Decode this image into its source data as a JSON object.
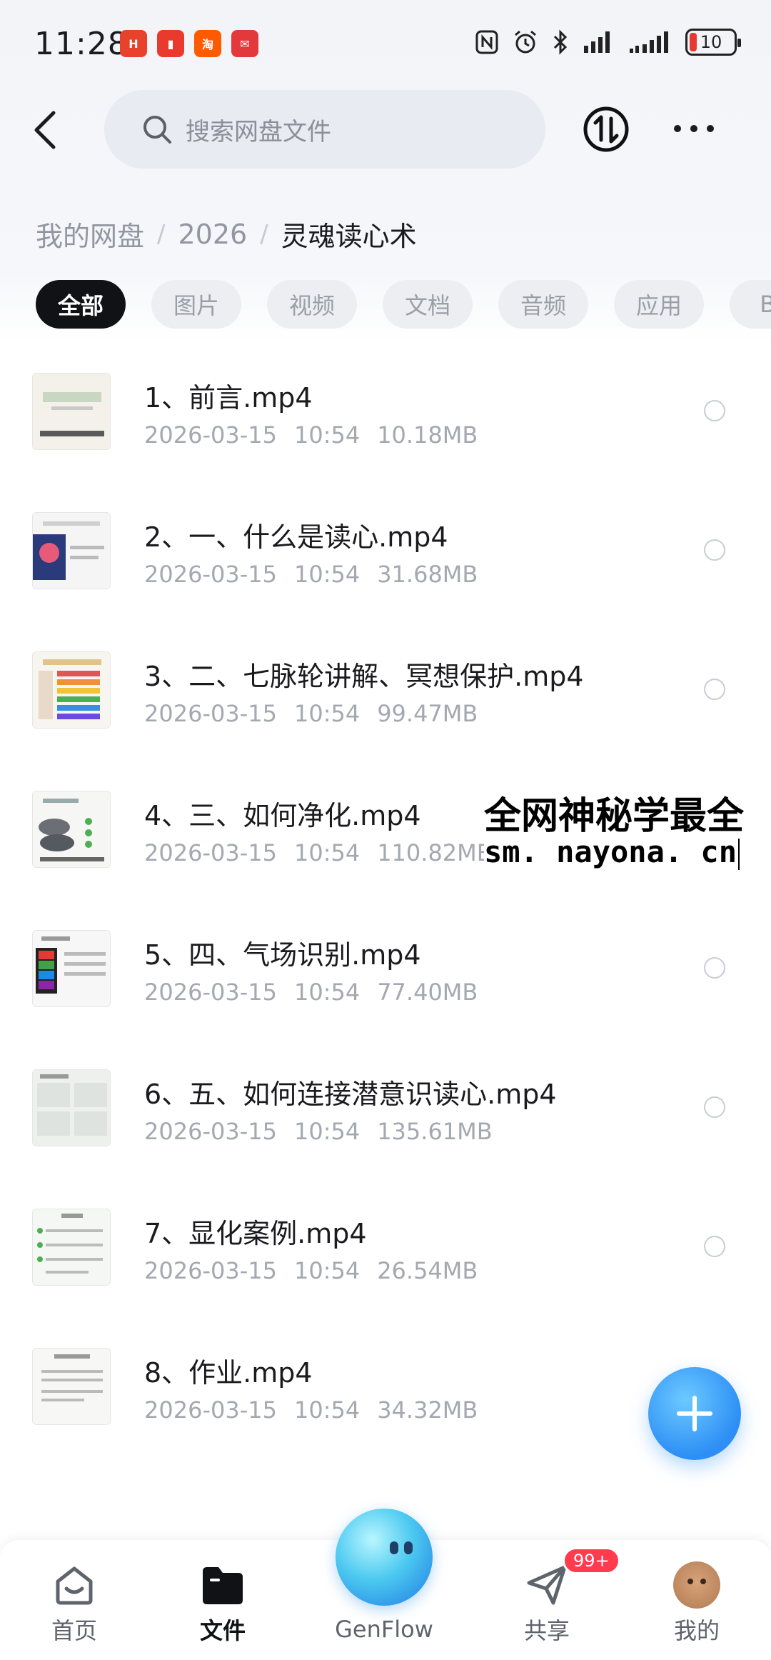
{
  "status_bar": {
    "time": "11:28",
    "notif_icons": [
      "huawei-icon",
      "battery-app-icon",
      "taobao-icon",
      "mail-app-icon"
    ],
    "battery_level": "10"
  },
  "header": {
    "search_placeholder": "搜索网盘文件"
  },
  "breadcrumb": {
    "items": [
      "我的网盘",
      "2026",
      "灵魂读心术"
    ]
  },
  "filters": {
    "chips": [
      "全部",
      "图片",
      "视频",
      "文档",
      "音频",
      "应用",
      "BT"
    ],
    "active": 0
  },
  "files": [
    {
      "name": "1、前言.mp4",
      "date": "2026-03-15",
      "time": "10:54",
      "size": "10.18MB"
    },
    {
      "name": "2、一、什么是读心.mp4",
      "date": "2026-03-15",
      "time": "10:54",
      "size": "31.68MB"
    },
    {
      "name": "3、二、七脉轮讲解、冥想保护.mp4",
      "date": "2026-03-15",
      "time": "10:54",
      "size": "99.47MB"
    },
    {
      "name": "4、三、如何净化.mp4",
      "date": "2026-03-15",
      "time": "10:54",
      "size": "110.82MB"
    },
    {
      "name": "5、四、气场识别.mp4",
      "date": "2026-03-15",
      "time": "10:54",
      "size": "77.40MB"
    },
    {
      "name": "6、五、如何连接潜意识读心.mp4",
      "date": "2026-03-15",
      "time": "10:54",
      "size": "135.61MB"
    },
    {
      "name": "7、显化案例.mp4",
      "date": "2026-03-15",
      "time": "10:54",
      "size": "26.54MB"
    },
    {
      "name": "8、作业.mp4",
      "date": "2026-03-15",
      "time": "10:54",
      "size": "34.32MB"
    }
  ],
  "watermark": {
    "line1": "全网神秘学最全",
    "line2": "sm. nayona. cn"
  },
  "bottom_nav": {
    "home": "首页",
    "files": "文件",
    "genflow": "GenFlow",
    "share": "共享",
    "me": "我的",
    "share_badge": "99+"
  },
  "colors": {
    "accent": "#2d8ef5",
    "active_chip": "#111216",
    "badge": "#ff3b4e"
  }
}
